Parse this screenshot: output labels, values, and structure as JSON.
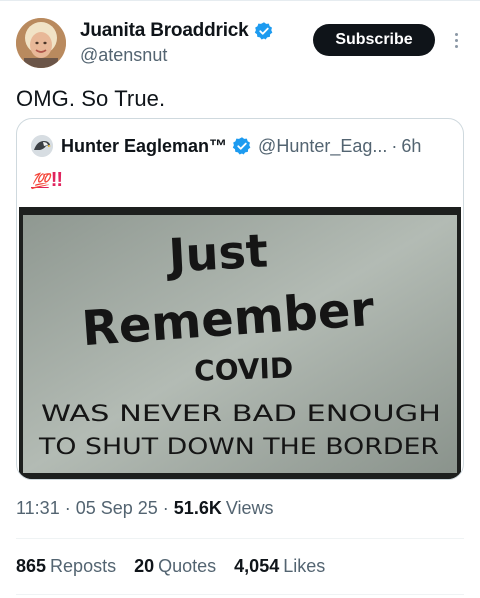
{
  "author": {
    "display_name": "Juanita Broaddrick",
    "handle": "@atensnut",
    "subscribe_label": "Subscribe"
  },
  "tweet": {
    "text": "OMG.  So True."
  },
  "quoted": {
    "display_name": "Hunter Eagleman™",
    "handle": "@Hunter_Eag...",
    "time": "6h",
    "text_emoji": "💯",
    "text_bangs": "!!",
    "image_text": {
      "line1": "Just",
      "line2": "Remember",
      "line3": "COVID",
      "line4": "WAS NEVER BAD ENOUGH",
      "line5": "TO SHUT DOWN THE BORDER"
    }
  },
  "meta": {
    "time": "11:31",
    "date": "05 Sep 25",
    "views_count": "51.6K",
    "views_label": "Views"
  },
  "stats": {
    "reposts_count": "865",
    "reposts_label": "Reposts",
    "quotes_count": "20",
    "quotes_label": "Quotes",
    "likes_count": "4,054",
    "likes_label": "Likes"
  },
  "colors": {
    "verified": "#1d9bf0",
    "subscribe_bg": "#0f1419",
    "secondary_text": "#536471",
    "emoji_red": "#e0245e"
  }
}
